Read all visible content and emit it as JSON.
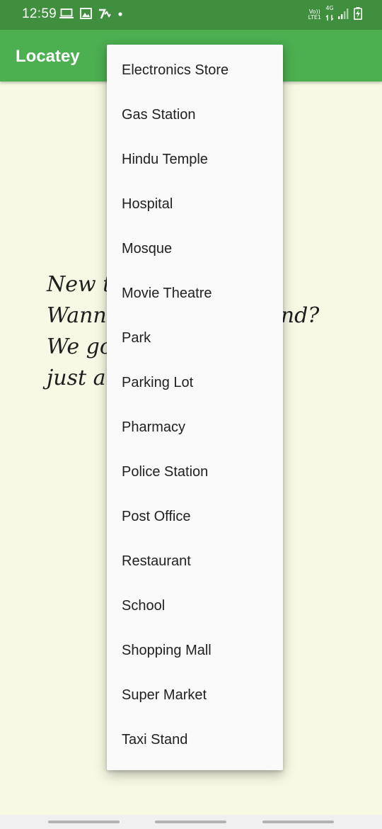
{
  "status_bar": {
    "time": "12:59",
    "left_icons": [
      "laptop-icon",
      "image-icon",
      "app-notification-icon",
      "dot-icon"
    ],
    "volte_top": "Vo))",
    "volte_bottom": "LTE1",
    "network_label": "4G",
    "right_icons": [
      "signal-icon",
      "battery-charging-icon"
    ]
  },
  "app_bar": {
    "title": "Locatey",
    "color": "#4caf50"
  },
  "main": {
    "tagline": "New to\nWanna                    ound?\nWe go\njust a"
  },
  "dropdown": {
    "items": [
      "Electronics Store",
      "Gas Station",
      "Hindu Temple",
      "Hospital",
      "Mosque",
      "Movie Theatre",
      "Park",
      "Parking Lot",
      "Pharmacy",
      "Police Station",
      "Post Office",
      "Restaurant",
      "School",
      "Shopping Mall",
      "Super Market",
      "Taxi Stand"
    ]
  }
}
